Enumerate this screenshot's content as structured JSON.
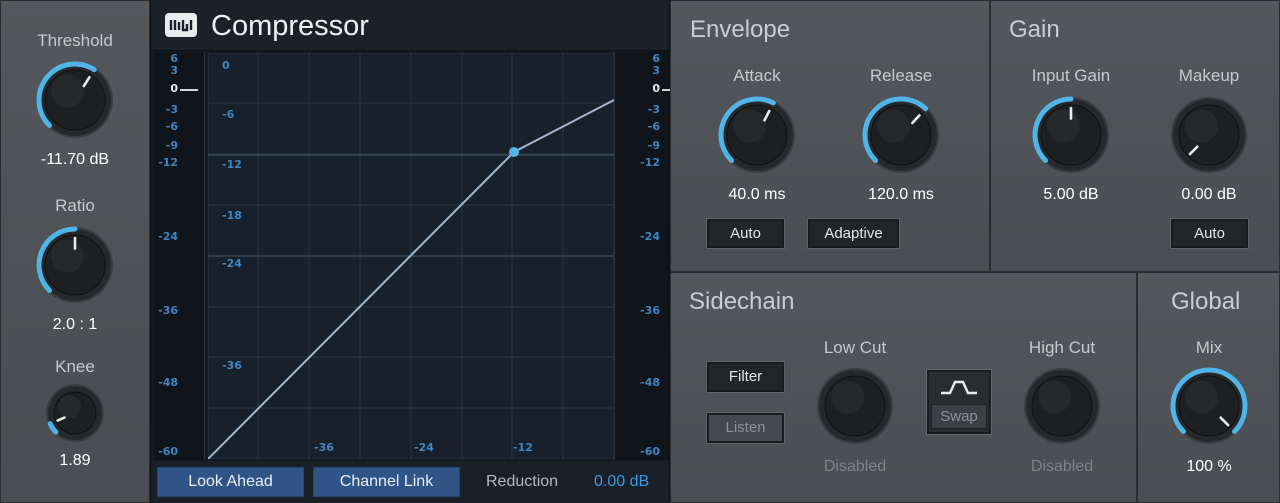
{
  "plugin": {
    "title": "Compressor",
    "logo": "presonus-logo-icon"
  },
  "left": {
    "threshold": {
      "label": "Threshold",
      "value": "-11.70 dB",
      "level": 0.62
    },
    "ratio": {
      "label": "Ratio",
      "value": "2.0 : 1",
      "level": 0.5
    },
    "knee": {
      "label": "Knee",
      "value": "1.89",
      "level": 0.08
    }
  },
  "graph": {
    "left_scale": [
      "6",
      "3",
      "0",
      "-3",
      "-6",
      "-9",
      "-12",
      "-24",
      "-36",
      "-48",
      "-60"
    ],
    "right_scale": [
      "6",
      "3",
      "0",
      "-3",
      "-6",
      "-9",
      "-12",
      "-24",
      "-36",
      "-48",
      "-60"
    ],
    "inner_y_labels": [
      "0",
      "-6",
      "-12",
      "-18",
      "-24",
      "-36"
    ],
    "inner_x_labels": [
      "-36",
      "-24",
      "-12"
    ],
    "accent": "#4fb4e8"
  },
  "bottom": {
    "look_ahead": "Look Ahead",
    "channel_link": "Channel Link",
    "reduction_label": "Reduction",
    "reduction_value": "0.00 dB"
  },
  "envelope": {
    "title": "Envelope",
    "attack": {
      "label": "Attack",
      "value": "40.0 ms",
      "level": 0.6
    },
    "release": {
      "label": "Release",
      "value": "120.0 ms",
      "level": 0.66
    },
    "auto": "Auto",
    "adaptive": "Adaptive"
  },
  "gain": {
    "title": "Gain",
    "input_gain": {
      "label": "Input Gain",
      "value": "5.00 dB",
      "level": 0.5
    },
    "makeup": {
      "label": "Makeup",
      "value": "0.00 dB",
      "level": 0.0
    },
    "auto": "Auto"
  },
  "sidechain": {
    "title": "Sidechain",
    "filter": "Filter",
    "listen": "Listen",
    "low_cut": {
      "label": "Low Cut",
      "value": "Disabled"
    },
    "high_cut": {
      "label": "High Cut",
      "value": "Disabled"
    },
    "swap": "Swap",
    "swap_icon": "bandpass-filter-icon"
  },
  "global": {
    "title": "Global",
    "mix": {
      "label": "Mix",
      "value": "100 %",
      "level": 1.0
    }
  }
}
